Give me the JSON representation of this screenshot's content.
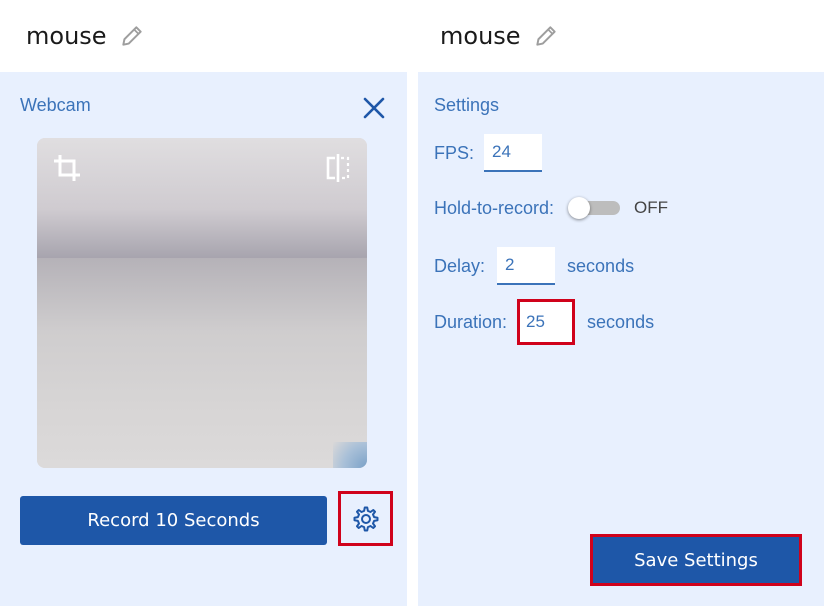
{
  "left": {
    "title": "mouse",
    "panel_heading": "Webcam",
    "record_button_label": "Record 10 Seconds"
  },
  "right": {
    "title": "mouse",
    "panel_heading": "Settings",
    "fps": {
      "label": "FPS:",
      "value": "24"
    },
    "hold_to_record": {
      "label": "Hold-to-record:",
      "state": "OFF"
    },
    "delay": {
      "label": "Delay:",
      "value": "2",
      "unit": "seconds"
    },
    "duration": {
      "label": "Duration:",
      "value": "25",
      "unit": "seconds"
    },
    "save_button_label": "Save Settings"
  },
  "icons": [
    "pencil-icon",
    "close-icon",
    "crop-icon",
    "mirror-icon",
    "gear-icon"
  ],
  "colors": {
    "accent": "#1e57a8",
    "text_blue": "#3b73b9",
    "panel_bg": "#e8f0fe",
    "highlight_red": "#d0021b"
  }
}
